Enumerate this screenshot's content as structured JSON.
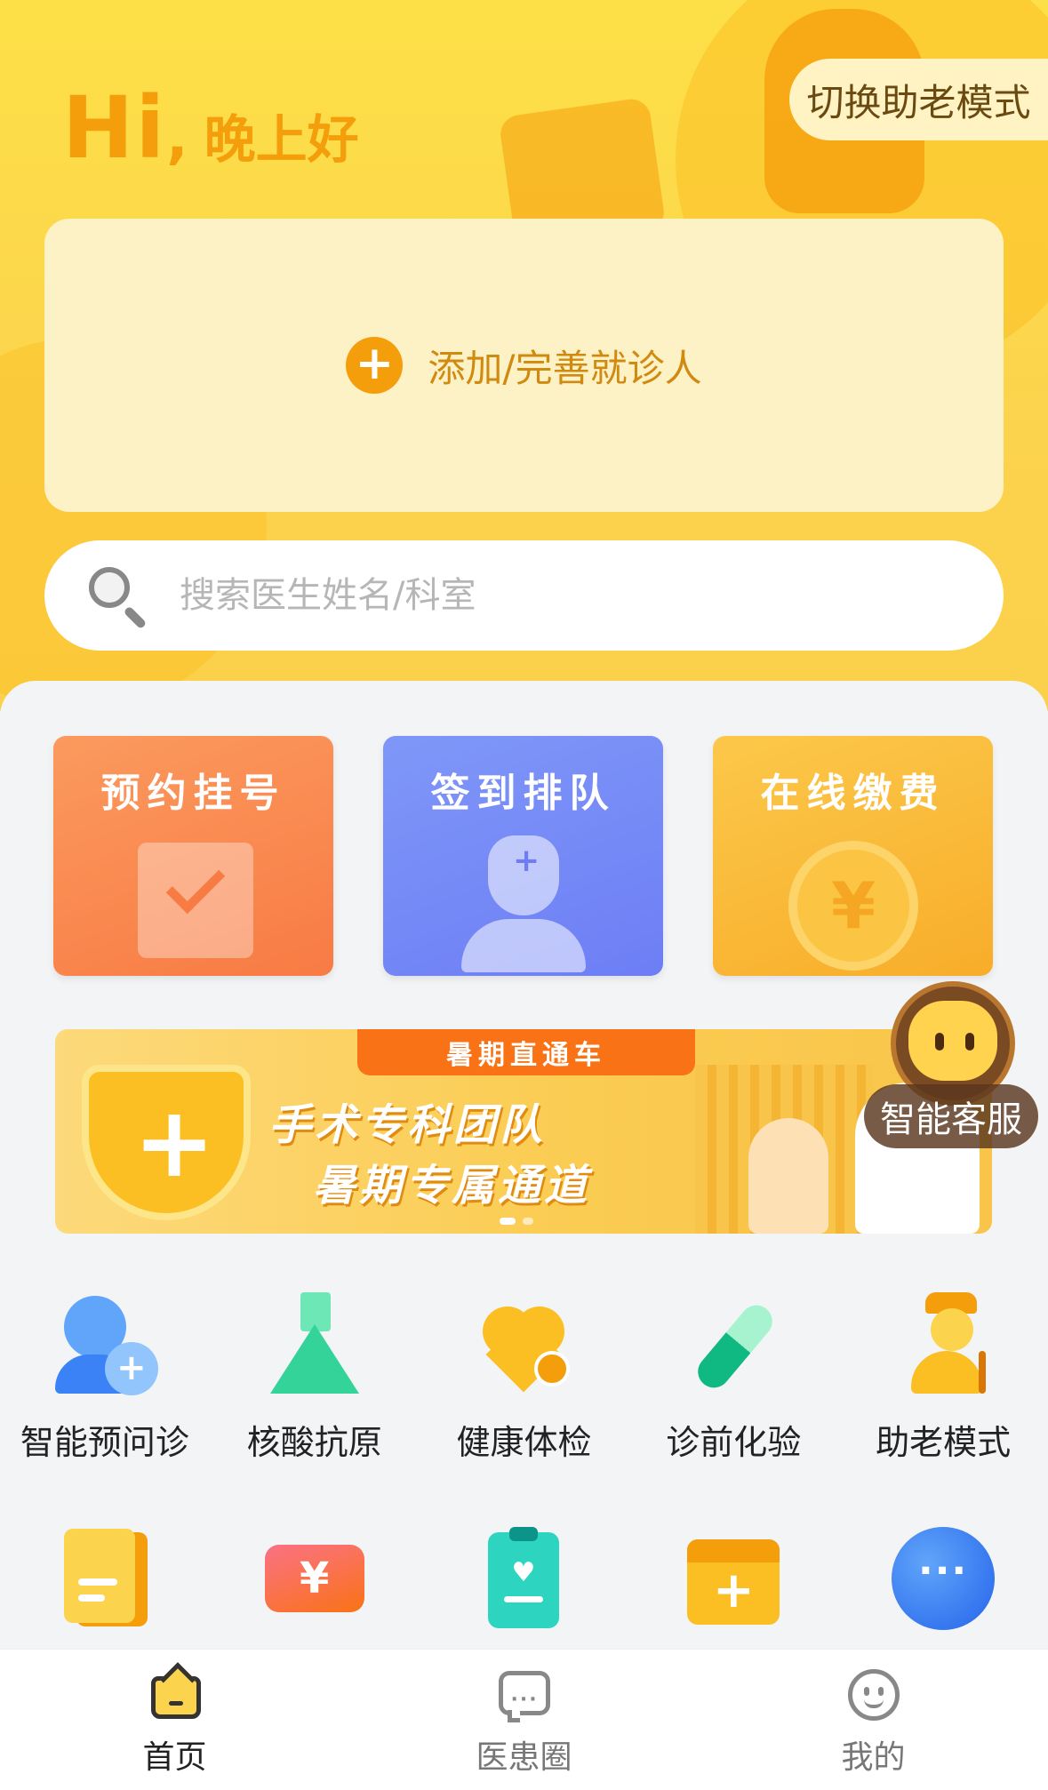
{
  "header": {
    "greeting_hi": "Hi",
    "greeting_comma": ",",
    "greeting_sub": "晚上好",
    "mode_switch_label": "切换助老模式"
  },
  "patient_card": {
    "label": "添加/完善就诊人"
  },
  "search": {
    "placeholder": "搜索医生姓名/科室"
  },
  "quick_actions": [
    {
      "label": "预约挂号",
      "icon": "calendar-check-icon"
    },
    {
      "label": "签到排队",
      "icon": "doctor-icon"
    },
    {
      "label": "在线缴费",
      "icon": "yuan-coin-icon"
    }
  ],
  "banner": {
    "tag": "暑期直通车",
    "line1": "手术专科团队",
    "line2": "暑期专属通道",
    "slide_count": 2,
    "active_slide": 1
  },
  "assistant": {
    "label": "智能客服"
  },
  "services_row1": [
    {
      "label": "智能预问诊",
      "icon": "doctor-consult-icon"
    },
    {
      "label": "核酸抗原",
      "icon": "flask-icon"
    },
    {
      "label": "健康体检",
      "icon": "heart-pulse-icon"
    },
    {
      "label": "诊前化验",
      "icon": "test-tube-icon"
    },
    {
      "label": "助老模式",
      "icon": "elder-icon"
    }
  ],
  "services_row2": [
    {
      "icon": "report-icon"
    },
    {
      "icon": "ticket-yuan-icon"
    },
    {
      "icon": "clipboard-heart-icon"
    },
    {
      "icon": "calendar-plus-icon"
    },
    {
      "icon": "more-icon"
    }
  ],
  "tabbar": [
    {
      "label": "首页",
      "icon": "home-icon",
      "active": true
    },
    {
      "label": "医患圈",
      "icon": "chat-icon",
      "active": false
    },
    {
      "label": "我的",
      "icon": "profile-icon",
      "active": false
    }
  ],
  "colors": {
    "brand_yellow": "#fde047",
    "accent_orange": "#f59e0b",
    "quick_orange": "#f87b44",
    "quick_blue": "#6d7ef5",
    "quick_gold": "#f8ad2a"
  }
}
